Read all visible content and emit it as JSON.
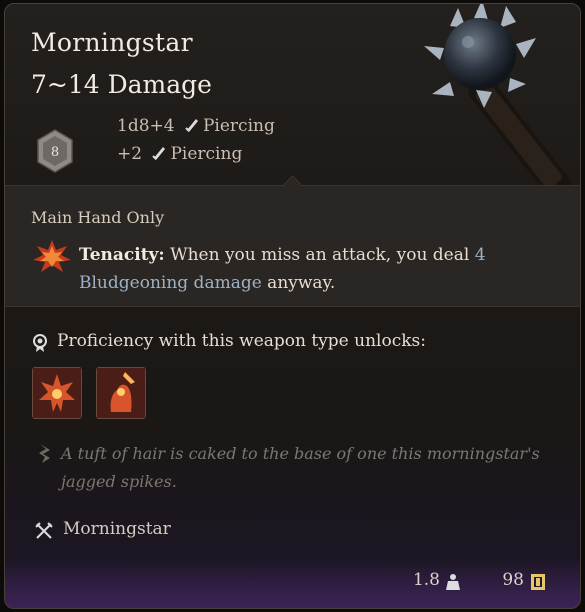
{
  "item": {
    "name": "Morningstar",
    "damage_range": "7~14 Damage",
    "die_label": "8",
    "damage_lines": [
      {
        "dice": "1d8+4",
        "type": "Piercing"
      },
      {
        "dice": "+2",
        "type": "Piercing"
      }
    ],
    "main_hand": "Main Hand Only",
    "tenacity": {
      "name": "Tenacity:",
      "text_before": " When you miss an attack, you deal ",
      "amount": "4",
      "damage_type": "Bludgeoning damage",
      "text_after": " anyway."
    },
    "proficiency_text": "Proficiency with this weapon type unlocks:",
    "unlock_icons": [
      "action-icon-1",
      "action-icon-2"
    ],
    "flavor_text": "A tuft of hair is caked to the base of one this morningstar's jagged spikes.",
    "weapon_type": "Morningstar",
    "weight": "1.8",
    "value": "98"
  },
  "colors": {
    "accent_blue": "#9fb2c4",
    "footer_purple": "#2e1d3f",
    "unlock_red": "#3a1c18"
  }
}
